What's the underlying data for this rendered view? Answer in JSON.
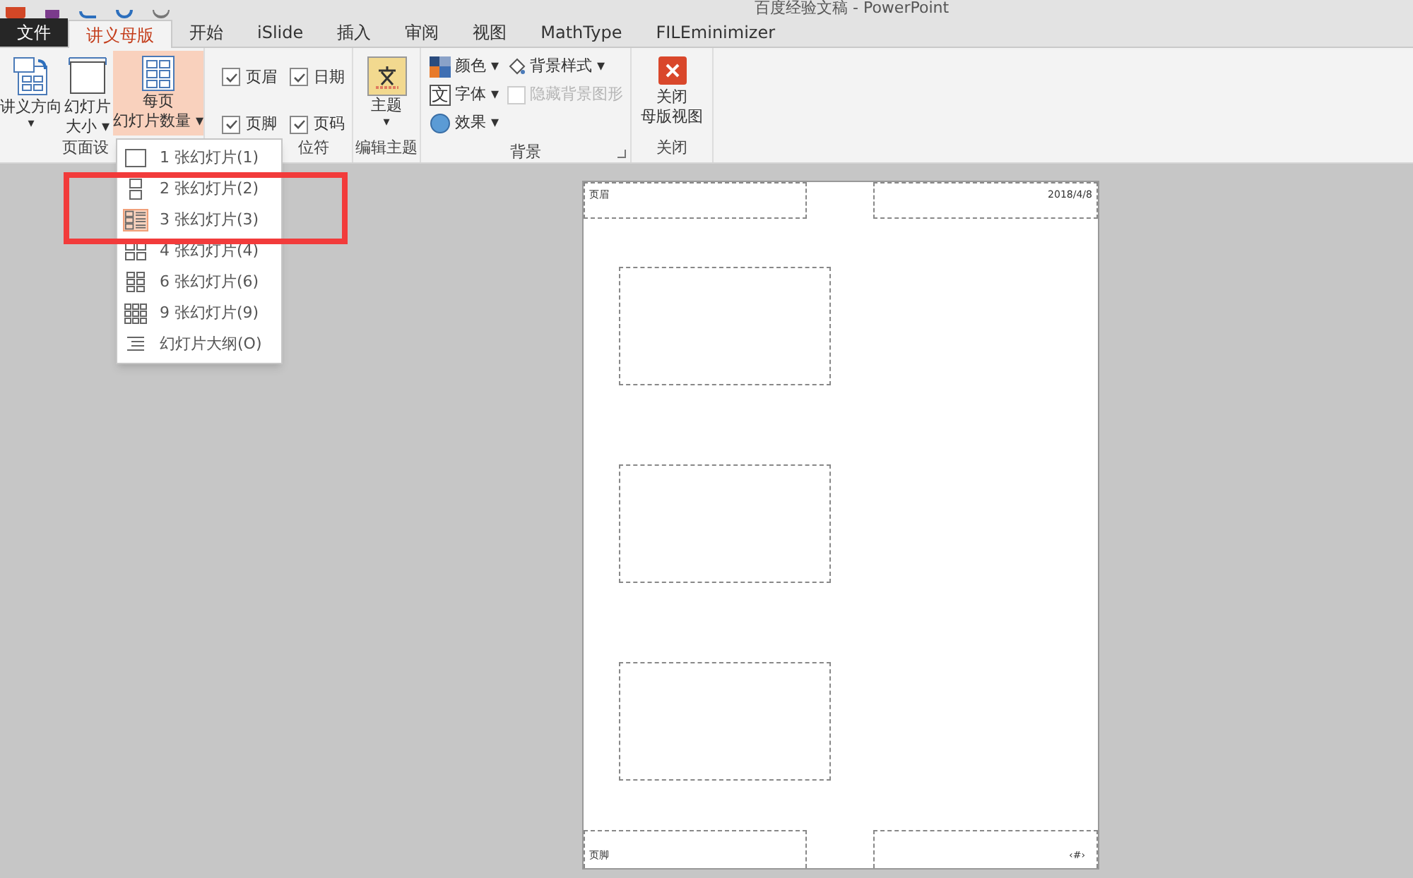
{
  "window": {
    "title": "百度经验文稿 - PowerPoint"
  },
  "tabs": [
    {
      "label": "文件",
      "kind": "file",
      "selected": false
    },
    {
      "label": "讲义母版",
      "kind": "tab",
      "selected": true
    },
    {
      "label": "开始",
      "kind": "tab",
      "selected": false
    },
    {
      "label": "iSlide",
      "kind": "tab",
      "selected": false
    },
    {
      "label": "插入",
      "kind": "tab",
      "selected": false
    },
    {
      "label": "审阅",
      "kind": "tab",
      "selected": false
    },
    {
      "label": "视图",
      "kind": "tab",
      "selected": false
    },
    {
      "label": "MathType",
      "kind": "tab",
      "selected": false
    },
    {
      "label": "FILEminimizer",
      "kind": "tab",
      "selected": false
    }
  ],
  "ribbon": {
    "page_setup": {
      "label": "页面设",
      "buttons": [
        {
          "lines": [
            "讲义方向"
          ],
          "caret": "▾",
          "kind": "orientation",
          "selected": false
        },
        {
          "lines": [
            "幻灯片",
            "大小 ▾"
          ],
          "kind": "size",
          "selected": false
        },
        {
          "lines": [
            "每页",
            "幻灯片数量 ▾"
          ],
          "kind": "grid",
          "selected": true
        }
      ]
    },
    "placeholders": {
      "label": "位符",
      "items": [
        {
          "label": "页眉",
          "checked": true
        },
        {
          "label": "日期",
          "checked": true
        },
        {
          "label": "页脚",
          "checked": true
        },
        {
          "label": "页码",
          "checked": true
        }
      ]
    },
    "edit_theme": {
      "label": "编辑主题",
      "button": {
        "label": "主题",
        "caret": "▾"
      }
    },
    "background": {
      "label": "背景",
      "items": [
        {
          "label": "颜色 ▾",
          "kind": "colors"
        },
        {
          "label": "字体 ▾",
          "kind": "fonts",
          "icon": "文"
        },
        {
          "label": "效果 ▾",
          "kind": "effects"
        }
      ],
      "style": {
        "label": "背景样式 ▾"
      },
      "hide_graphics": {
        "label": "隐藏背景图形",
        "checked": false,
        "disabled": true
      }
    },
    "close": {
      "label": "关闭",
      "button": {
        "lines": [
          "关闭",
          "母版视图"
        ]
      }
    }
  },
  "dropdown": {
    "items": [
      {
        "label": "1 张幻灯片(1)",
        "kind": "one",
        "selected": false
      },
      {
        "label": "2 张幻灯片(2)",
        "kind": "two",
        "selected": false
      },
      {
        "label": "3 张幻灯片(3)",
        "kind": "three",
        "selected": true
      },
      {
        "label": "4 张幻灯片(4)",
        "kind": "four",
        "selected": false
      },
      {
        "label": "6 张幻灯片(6)",
        "kind": "six",
        "selected": false
      },
      {
        "label": "9 张幻灯片(9)",
        "kind": "nine",
        "selected": false
      },
      {
        "label": "幻灯片大纲(O)",
        "kind": "outline",
        "selected": false
      }
    ]
  },
  "handout": {
    "header": "页眉",
    "date": "2018/4/8",
    "footer": "页脚",
    "page_number": "‹#›",
    "slides": [
      {
        "kind": "slide"
      },
      {
        "kind": "slide"
      },
      {
        "kind": "slide"
      }
    ]
  }
}
